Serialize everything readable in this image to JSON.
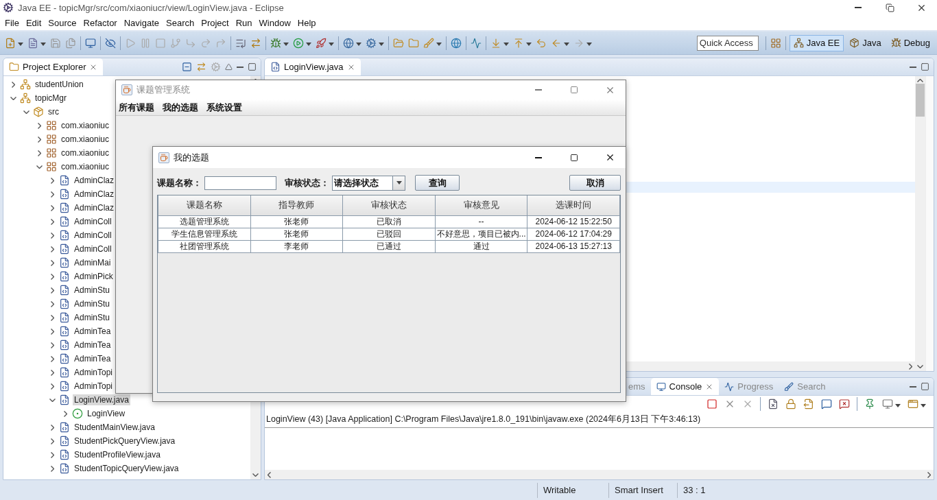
{
  "window": {
    "title": "Java EE - topicMgr/src/com/xiaoniucr/view/LoginView.java - Eclipse"
  },
  "menu": [
    "File",
    "Edit",
    "Source",
    "Refactor",
    "Navigate",
    "Search",
    "Project",
    "Run",
    "Window",
    "Help"
  ],
  "quick_access": {
    "placeholder": "Quick Access"
  },
  "perspectives": [
    {
      "label": "Java EE",
      "selected": true
    },
    {
      "label": "Java",
      "selected": false
    },
    {
      "label": "Debug",
      "selected": false
    }
  ],
  "project_explorer": {
    "title": "Project Explorer",
    "tree": [
      {
        "label": "studentUnion",
        "kind": "project",
        "expanded": false,
        "selected": false
      },
      {
        "label": "topicMgr",
        "kind": "project",
        "expanded": true,
        "selected": false,
        "children": [
          {
            "label": "src",
            "kind": "source-folder",
            "expanded": true,
            "selected": false,
            "children": [
              {
                "label": "com.xiaoniuc",
                "kind": "package",
                "expanded": false,
                "selected": false
              },
              {
                "label": "com.xiaoniuc",
                "kind": "package",
                "expanded": false,
                "selected": false
              },
              {
                "label": "com.xiaoniuc",
                "kind": "package",
                "expanded": false,
                "selected": false
              },
              {
                "label": "com.xiaoniuc",
                "kind": "package",
                "expanded": true,
                "selected": false,
                "children": [
                  {
                    "label": "AdminClaz",
                    "kind": "java-file",
                    "expanded": false,
                    "selected": false
                  },
                  {
                    "label": "AdminClaz",
                    "kind": "java-file",
                    "expanded": false,
                    "selected": false
                  },
                  {
                    "label": "AdminClaz",
                    "kind": "java-file",
                    "expanded": false,
                    "selected": false
                  },
                  {
                    "label": "AdminColl",
                    "kind": "java-file",
                    "expanded": false,
                    "selected": false
                  },
                  {
                    "label": "AdminColl",
                    "kind": "java-file",
                    "expanded": false,
                    "selected": false
                  },
                  {
                    "label": "AdminColl",
                    "kind": "java-file",
                    "expanded": false,
                    "selected": false
                  },
                  {
                    "label": "AdminMai",
                    "kind": "java-file",
                    "expanded": false,
                    "selected": false
                  },
                  {
                    "label": "AdminPick",
                    "kind": "java-file",
                    "expanded": false,
                    "selected": false
                  },
                  {
                    "label": "AdminStu",
                    "kind": "java-file",
                    "expanded": false,
                    "selected": false
                  },
                  {
                    "label": "AdminStu",
                    "kind": "java-file",
                    "expanded": false,
                    "selected": false
                  },
                  {
                    "label": "AdminStu",
                    "kind": "java-file",
                    "expanded": false,
                    "selected": false
                  },
                  {
                    "label": "AdminTea",
                    "kind": "java-file",
                    "expanded": false,
                    "selected": false
                  },
                  {
                    "label": "AdminTea",
                    "kind": "java-file",
                    "expanded": false,
                    "selected": false
                  },
                  {
                    "label": "AdminTea",
                    "kind": "java-file",
                    "expanded": false,
                    "selected": false
                  },
                  {
                    "label": "AdminTopi",
                    "kind": "java-file",
                    "expanded": false,
                    "selected": false
                  },
                  {
                    "label": "AdminTopi",
                    "kind": "java-file",
                    "expanded": false,
                    "selected": false
                  },
                  {
                    "label": "LoginView.java",
                    "kind": "java-file",
                    "expanded": true,
                    "selected": true,
                    "children": [
                      {
                        "label": "LoginView",
                        "kind": "class",
                        "expanded": false,
                        "selected": false
                      }
                    ]
                  },
                  {
                    "label": "StudentMainView.java",
                    "kind": "java-file",
                    "expanded": false,
                    "selected": false
                  },
                  {
                    "label": "StudentPickQueryView.java",
                    "kind": "java-file",
                    "expanded": false,
                    "selected": false
                  },
                  {
                    "label": "StudentProfileView.java",
                    "kind": "java-file",
                    "expanded": false,
                    "selected": false
                  },
                  {
                    "label": "StudentTopicQueryView.java",
                    "kind": "java-file",
                    "expanded": false,
                    "selected": false
                  }
                ]
              }
            ]
          }
        ]
      }
    ]
  },
  "editor": {
    "tabs": [
      {
        "label": "LoginView.java",
        "selected": true
      }
    ]
  },
  "console_panel": {
    "tabs": [
      {
        "label": "ems",
        "selected": false
      },
      {
        "label": "Console",
        "selected": true
      },
      {
        "label": "Progress",
        "selected": false
      },
      {
        "label": "Search",
        "selected": false
      }
    ],
    "process": "LoginView (43) [Java Application] C:\\Program Files\\Java\\jre1.8.0_191\\bin\\javaw.exe (2024年6月13日 下午3:46:13)"
  },
  "status_bar": [
    "Writable",
    "Smart Insert",
    "33 : 1"
  ],
  "app_window": {
    "title": "课题管理系统",
    "menu": [
      "所有课题",
      "我的选题",
      "系统设置"
    ]
  },
  "dialog": {
    "title": "我的选题",
    "name_label": "课题名称：",
    "status_label": "审核状态：",
    "status_select": {
      "value": "请选择状态"
    },
    "query_button": "查询",
    "cancel_button": "取消",
    "table": {
      "columns": [
        "课题名称",
        "指导教师",
        "审核状态",
        "审核意见",
        "选课时间"
      ],
      "rows": [
        [
          "选题管理系统",
          "张老师",
          "已取消",
          "--",
          "2024-06-12 15:22:50"
        ],
        [
          "学生信息管理系统",
          "张老师",
          "已驳回",
          "不好意思，项目已被内...",
          "2024-06-12 17:04:29"
        ],
        [
          "社团管理系统",
          "李老师",
          "已通过",
          "通过",
          "2024-06-13 15:27:13"
        ]
      ]
    }
  }
}
